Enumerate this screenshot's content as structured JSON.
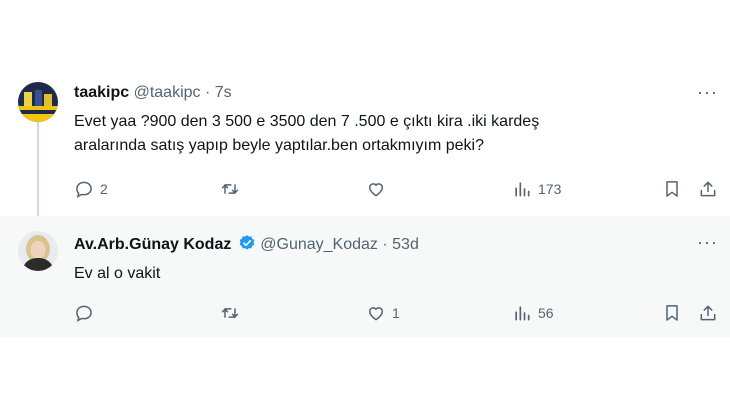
{
  "tweet1": {
    "display_name": "taakipc",
    "handle": "@taakipc",
    "separator": "·",
    "time": "7s",
    "text_line1": "Evet yaa ?900 den 3 500 e 3500 den 7 .500 e çıktı kira .iki kardeş",
    "text_line2": "aralarında satış  yapıp beyle yaptılar.ben ortakmıyım peki?",
    "replies": "2",
    "retweets": "",
    "likes": "",
    "views": "173"
  },
  "tweet2": {
    "display_name": "Av.Arb.Günay Kodaz",
    "handle": "@Gunay_Kodaz",
    "separator": "·",
    "time": "53d",
    "text": "Ev al o vakit",
    "replies": "",
    "retweets": "",
    "likes": "1",
    "views": "56"
  },
  "more_glyph": "···",
  "colors": {
    "verified": "#1d9bf0",
    "muted": "#536471",
    "reply_bg": "#f7f9f9"
  },
  "icons": [
    "reply-icon",
    "retweet-icon",
    "like-icon",
    "views-icon",
    "bookmark-icon",
    "share-icon",
    "more-icon",
    "verified-badge-icon"
  ]
}
